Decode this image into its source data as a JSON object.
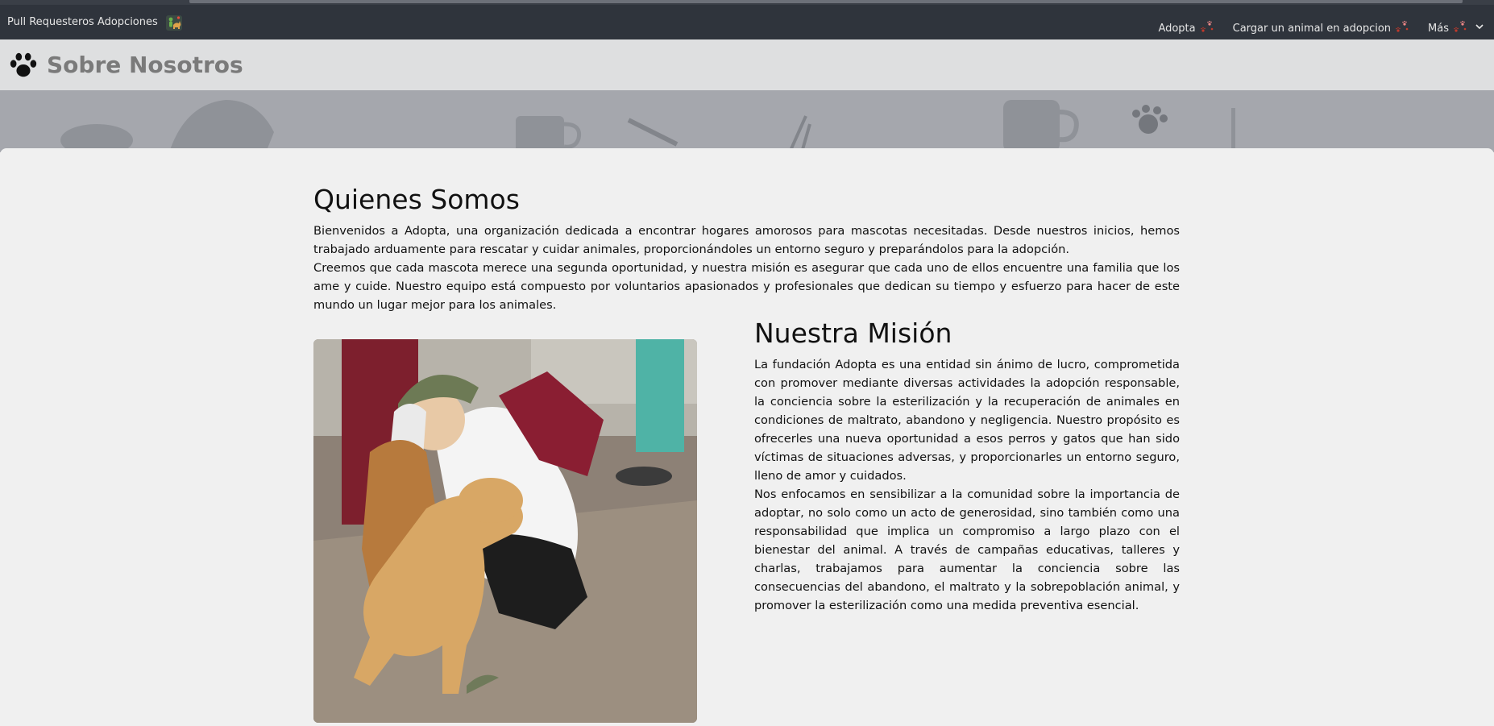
{
  "navbar": {
    "brand": "Pull Requesteros Adopciones",
    "links": [
      {
        "label": "Adopta"
      },
      {
        "label": "Cargar un animal en adopcion"
      },
      {
        "label": "Más"
      }
    ]
  },
  "header": {
    "title": "Sobre Nosotros"
  },
  "quienes": {
    "title": "Quienes Somos",
    "paragraphs": [
      "Bienvenidos a Adopta, una organización dedicada a encontrar hogares amorosos para mascotas necesitadas. Desde nuestros inicios, hemos trabajado arduamente para rescatar y cuidar animales, proporcionándoles un entorno seguro y preparándolos para la adopción.",
      "Creemos que cada mascota merece una segunda oportunidad, y nuestra misión es asegurar que cada uno de ellos encuentre una familia que los ame y cuide. Nuestro equipo está compuesto por voluntarios apasionados y profesionales que dedican su tiempo y esfuerzo para hacer de este mundo un lugar mejor para los animales."
    ]
  },
  "mision": {
    "title": "Nuestra Misión",
    "paragraphs": [
      "La fundación Adopta es una entidad sin ánimo de lucro, comprometida con promover mediante diversas actividades la adopción responsable, la conciencia sobre la esterilización y la recuperación de animales en condiciones de maltrato, abandono y negligencia. Nuestro propósito es ofrecerles una nueva oportunidad a esos perros y gatos que han sido víctimas de situaciones adversas, y proporcionarles un entorno seguro, lleno de amor y cuidados.",
      "Nos enfocamos en sensibilizar a la comunidad sobre la importancia de adoptar, no solo como un acto de generosidad, sino también como una responsabilidad que implica un compromiso a largo plazo con el bienestar del animal. A través de campañas educativas, talleres y charlas, trabajamos para aumentar la conciencia sobre las consecuencias del abandono, el maltrato y la sobrepoblación animal, y promover la esterilización como una medida preventiva esencial."
    ]
  },
  "icons": {
    "brand": "dog-and-person-icon",
    "nav": "paw-prints-icon",
    "header": "paw-icon",
    "dropdown": "chevron-down-icon"
  }
}
